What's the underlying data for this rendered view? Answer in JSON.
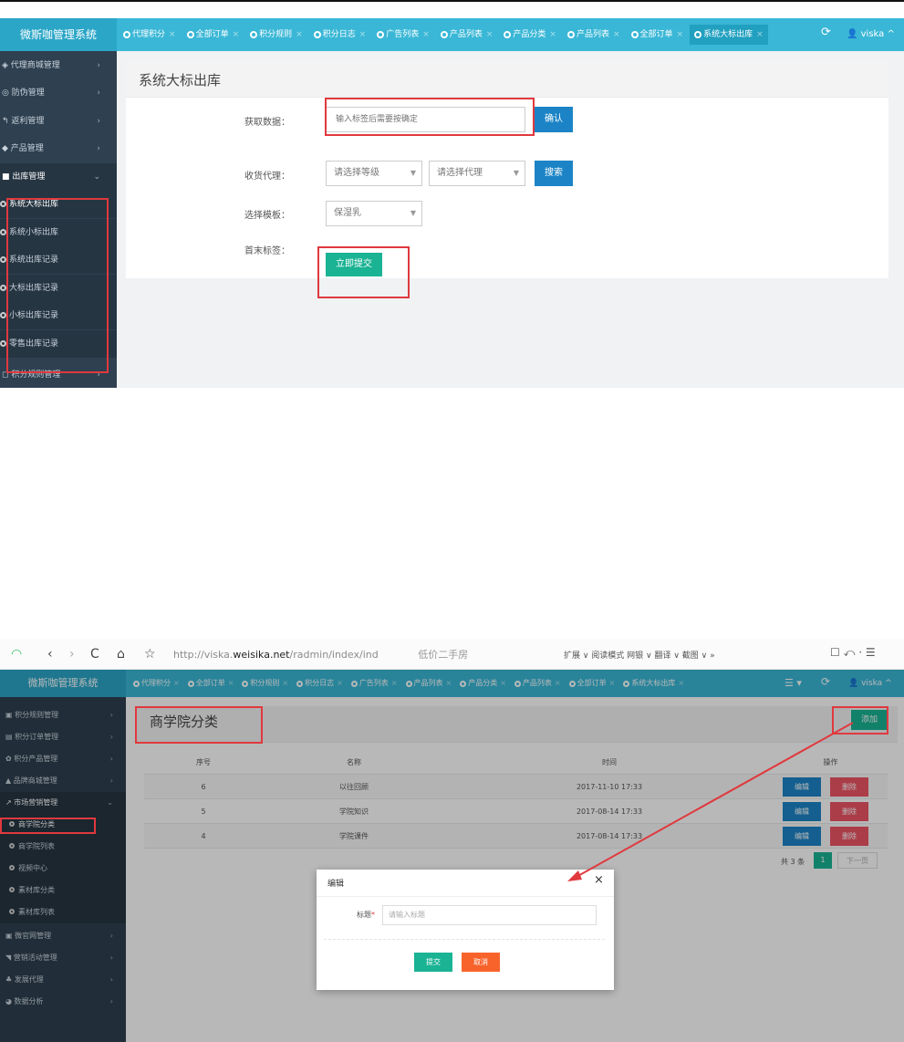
{
  "panel1": {
    "brand": "微斯咖管理系统",
    "tabs": [
      "代理积分",
      "全部订单",
      "积分规则",
      "积分日志",
      "广告列表",
      "产品列表",
      "产品分类",
      "产品列表",
      "全部订单",
      "系统大标出库"
    ],
    "tab_close": "×",
    "refresh_icon": "⟳",
    "user": "viska",
    "sidebar": [
      {
        "label": "代理商城管理",
        "arrow": "›"
      },
      {
        "label": "防伪管理",
        "arrow": "›"
      },
      {
        "label": "返利管理",
        "arrow": "›"
      },
      {
        "label": "产品管理",
        "arrow": "›"
      },
      {
        "label": "出库管理",
        "arrow": "⌄"
      }
    ],
    "sidebar_sub": [
      "系统大标出库",
      "系统小标出库",
      "系统出库记录",
      "大标出库记录",
      "小标出库记录",
      "零售出库记录"
    ],
    "sidebar_bottom": {
      "label": "积分规则管理",
      "arrow": "›"
    },
    "page_title": "系统大标出库",
    "form": {
      "fetch_label": "获取数据：",
      "fetch_placeholder": "输入标签后需要按确定",
      "confirm": "确认",
      "agent_label": "收货代理：",
      "level_select": "请选择等级",
      "agent_select": "请选择代理",
      "search": "搜索",
      "template_label": "选择模板：",
      "template_select": "保湿乳",
      "tag_label": "首末标签：",
      "submit": "立即提交"
    }
  },
  "panel2": {
    "browser": {
      "back": "‹",
      "forward": "›",
      "reload": "C",
      "home": "⌂",
      "star": "☆",
      "url_pre": "http://viska.",
      "url_domain": "weisika.net",
      "url_post": "/radmin/index/ind",
      "search_hint": "低价二手房",
      "tools": "扩展 ∨  阅读模式  网银 ∨  翻译 ∨  截图 ∨  »",
      "win_controls": "☐  ⤺ ·  ☰"
    },
    "brand": "微斯咖管理系统",
    "tabs": [
      "代理积分",
      "全部订单",
      "积分规则",
      "积分日志",
      "广告列表",
      "产品列表",
      "产品分类",
      "产品列表",
      "全部订单",
      "系统大标出库"
    ],
    "tab_close": "×",
    "menu_icon": "☰ ▾",
    "refresh_icon": "⟳",
    "user": "viska",
    "sidebar_top": [
      {
        "label": "积分规则管理",
        "arrow": "›"
      },
      {
        "label": "积分订单管理",
        "arrow": "›"
      },
      {
        "label": "积分产品管理",
        "arrow": "›"
      },
      {
        "label": "品牌商城管理",
        "arrow": "›"
      },
      {
        "label": "市场营销管理",
        "arrow": "⌄"
      }
    ],
    "sidebar_sub": [
      "商学院分类",
      "商学院列表",
      "视频中心",
      "素材库分类",
      "素材库列表"
    ],
    "sidebar_bottom": [
      {
        "label": "微官网管理",
        "arrow": "›"
      },
      {
        "label": "营销活动管理",
        "arrow": "›"
      },
      {
        "label": "发展代理",
        "arrow": "›"
      },
      {
        "label": "数据分析",
        "arrow": "›"
      }
    ],
    "page_title": "商学院分类",
    "add": "添加",
    "table": {
      "headers": [
        "序号",
        "名称",
        "时间",
        "操作"
      ],
      "rows": [
        {
          "id": "6",
          "name": "以往回顾",
          "time": "2017-11-10 17:33"
        },
        {
          "id": "5",
          "name": "学院知识",
          "time": "2017-08-14 17:33"
        },
        {
          "id": "4",
          "name": "学院课件",
          "time": "2017-08-14 17:33"
        }
      ],
      "edit": "编辑",
      "delete": "删除"
    },
    "pager": {
      "total": "共 3 条",
      "current": "1",
      "next": "下一页"
    },
    "modal": {
      "title": "编辑",
      "close": "×",
      "label": "标题",
      "required": "*",
      "placeholder": "请输入标题",
      "submit": "提交",
      "cancel": "取消"
    }
  },
  "colors": {
    "topbar": "#3ab7d6",
    "sidebar": "#2f4050",
    "primary_blue": "#1c84c6",
    "green": "#1ab394",
    "red": "#ed5565",
    "highlight": "#e0393e"
  }
}
